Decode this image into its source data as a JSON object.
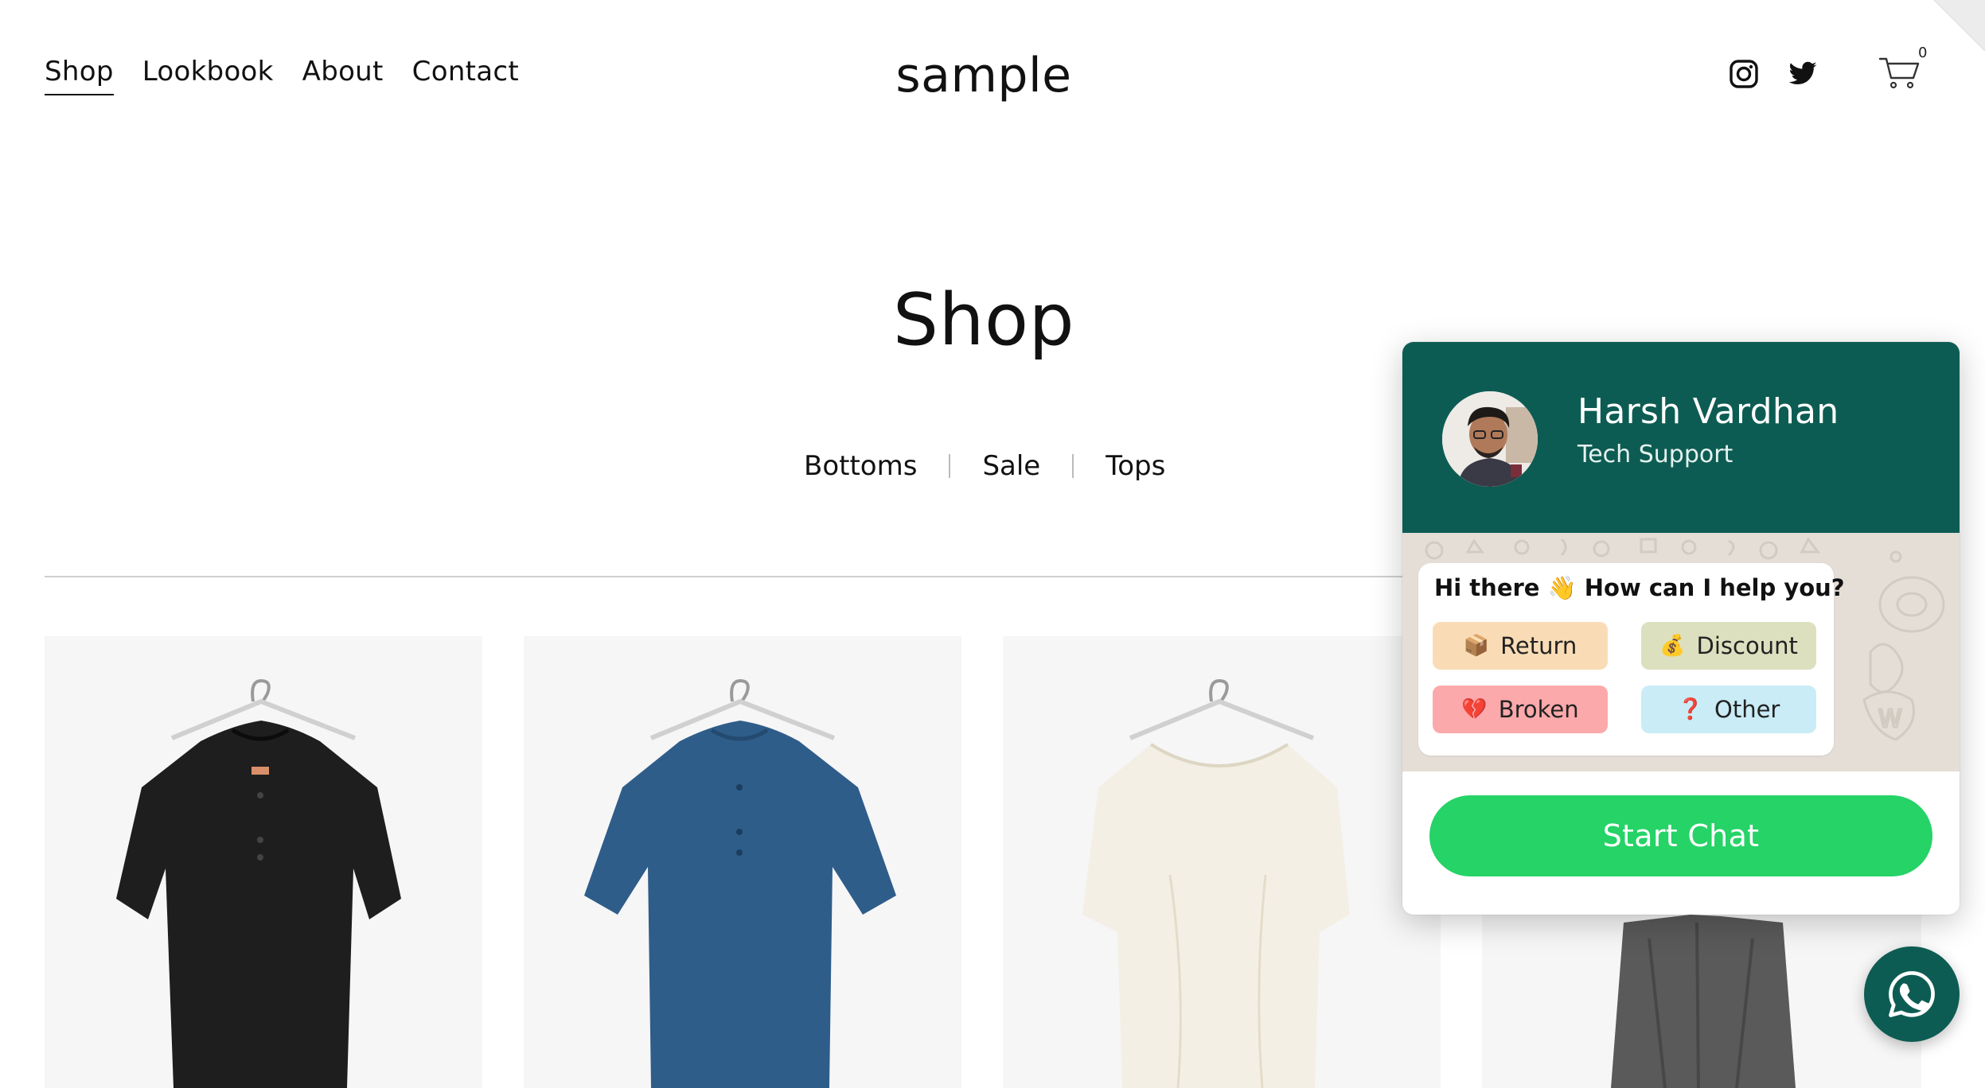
{
  "header": {
    "nav": [
      {
        "label": "Shop",
        "active": true
      },
      {
        "label": "Lookbook",
        "active": false
      },
      {
        "label": "About",
        "active": false
      },
      {
        "label": "Contact",
        "active": false
      }
    ],
    "logo": "sample",
    "social_icons": [
      "instagram-icon",
      "twitter-icon"
    ],
    "cart": {
      "icon": "cart-icon",
      "count": "0"
    }
  },
  "main": {
    "title": "Shop",
    "filters": [
      "Bottoms",
      "Sale",
      "Tops"
    ]
  },
  "products": [
    {
      "color": "#1e1e1e",
      "style": "black henley tunic"
    },
    {
      "color": "#2f5d8a",
      "style": "blue henley tunic"
    },
    {
      "color": "#f3efe4",
      "style": "cream scoop-neck dress"
    },
    {
      "color": "#5a5a5a",
      "style": "grey wrap"
    }
  ],
  "chat_widget": {
    "agent_name": "Harsh Vardhan",
    "agent_role": "Tech Support",
    "greeting": "Hi there 👋  How can I help you?",
    "options": [
      {
        "emoji": "📦",
        "label": "Return",
        "color": "#f9dcb6"
      },
      {
        "emoji": "💰",
        "label": "Discount",
        "color": "#dde0bf"
      },
      {
        "emoji": "💔",
        "label": "Broken",
        "color": "#fca9ab"
      },
      {
        "emoji": "❓",
        "label": "Other",
        "color": "#c9ecf6"
      }
    ],
    "cta": "Start Chat",
    "header_color": "#0d5c53",
    "cta_color": "#25d366"
  },
  "fab": {
    "icon": "whatsapp-icon",
    "color": "#0d5c53"
  }
}
